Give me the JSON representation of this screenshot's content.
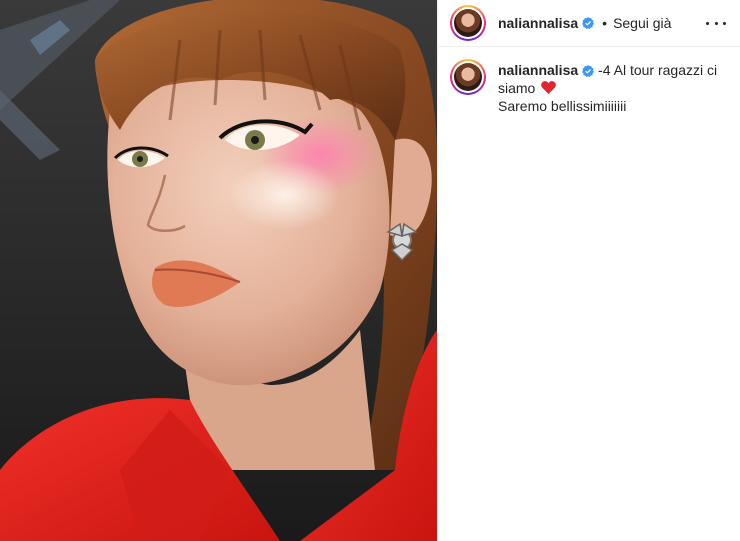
{
  "post": {
    "username": "naliannalisa",
    "separator": "•",
    "follow_label": "Segui già"
  },
  "caption": {
    "username": "naliannalisa",
    "line1": "-4 Al tour ragazzi ci siamo",
    "line2": "Saremo bellissimiiiiiii",
    "emoji": "red-heart-icon"
  },
  "icons": {
    "verified": "verified-badge-icon",
    "more": "more-options-icon"
  },
  "colors": {
    "verified_blue": "#3897f0",
    "heart_red": "#e0262f",
    "jacket_red": "#e8231f",
    "border": "#efefef"
  }
}
